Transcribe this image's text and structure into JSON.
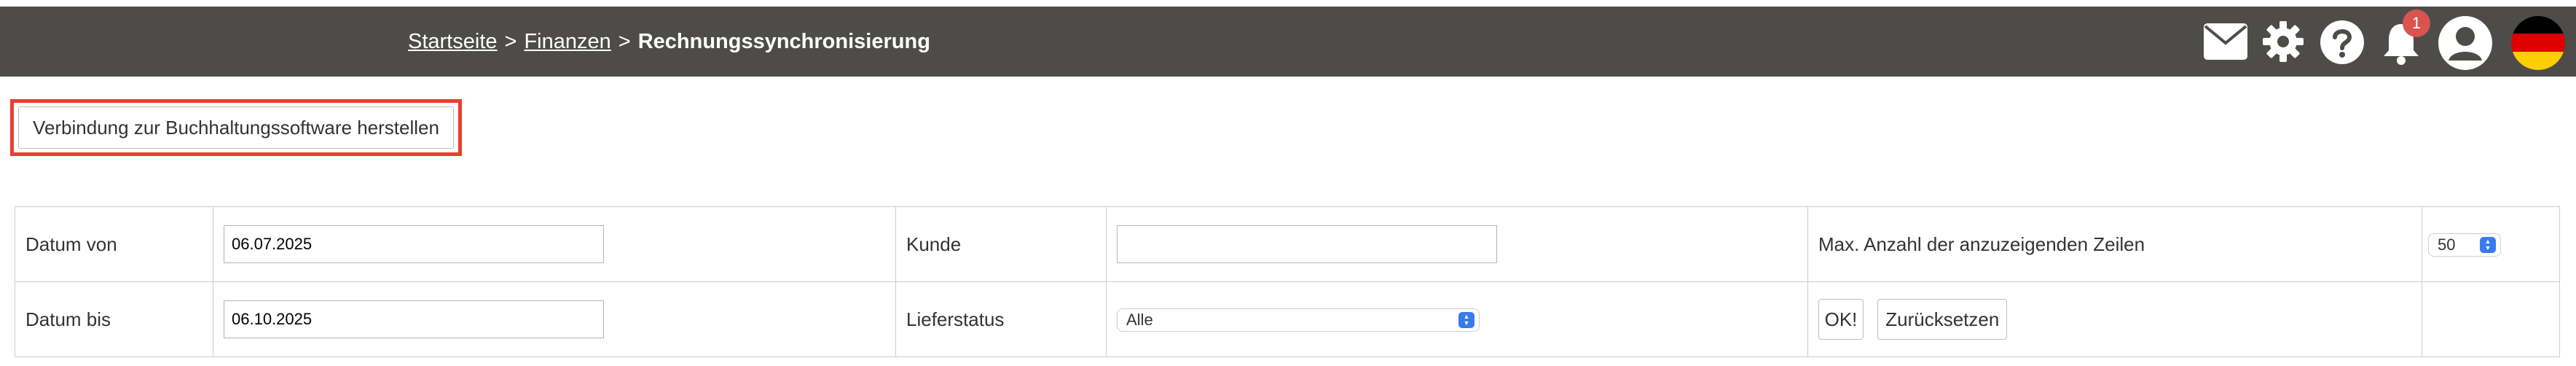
{
  "breadcrumb": {
    "home": "Startseite",
    "sep1": ">",
    "finance": "Finanzen",
    "sep2": ">",
    "current": "Rechnungssynchronisierung"
  },
  "header_icons": {
    "notification_count": "1",
    "names": [
      "mail-icon",
      "gear-icon",
      "help-icon",
      "bell-icon",
      "user-icon",
      "german-flag-icon"
    ]
  },
  "connect_button": {
    "label": "Verbindung zur Buchhaltungssoftware herstellen"
  },
  "filter": {
    "date_from": {
      "label": "Datum von",
      "value": "06.07.2025"
    },
    "date_to": {
      "label": "Datum bis",
      "value": "06.10.2025"
    },
    "customer": {
      "label": "Kunde",
      "value": ""
    },
    "delivery_status": {
      "label": "Lieferstatus",
      "value": "Alle"
    },
    "max_rows": {
      "label": "Max. Anzahl der anzuzeigenden Zeilen",
      "value": "50"
    },
    "ok_label": "OK!",
    "reset_label": "Zurücksetzen"
  },
  "colors": {
    "header_bg": "#4d4c49",
    "highlight": "#e8402c",
    "badge": "#d9534f",
    "select_arrow": "#3a7bea"
  }
}
